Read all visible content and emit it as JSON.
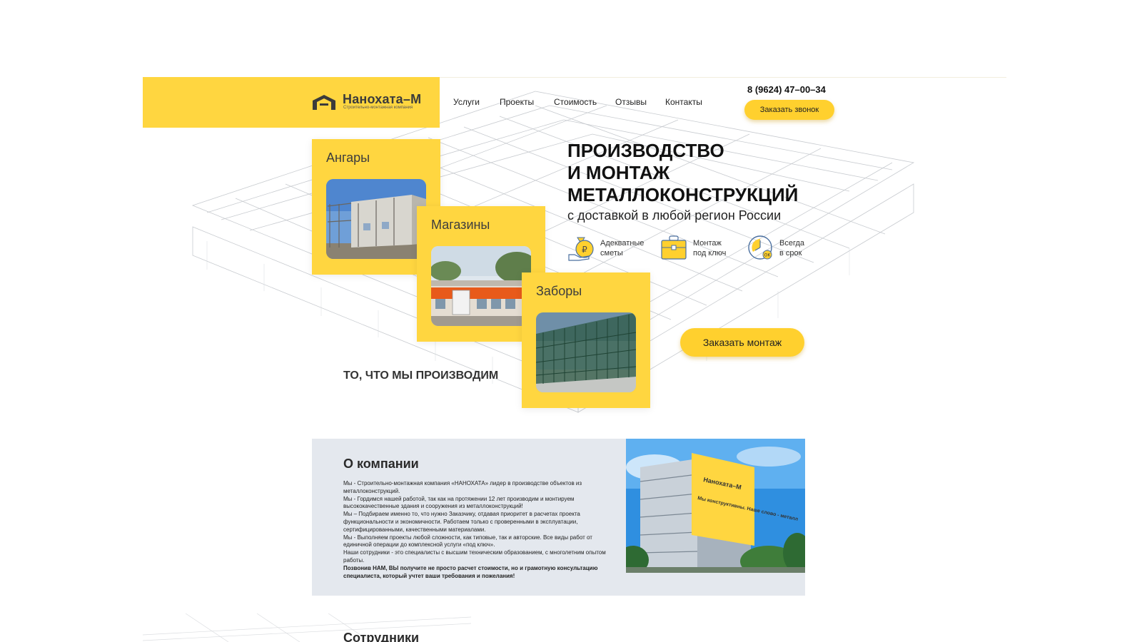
{
  "header": {
    "logo_name": "Нанохата–М",
    "logo_subtitle": "Строительно-монтажная компания",
    "nav": [
      "Услуги",
      "Проекты",
      "Стоимость",
      "Отзывы",
      "Контакты"
    ],
    "phone": "8 (9624) 47–00–34",
    "call_button": "Заказать звонок"
  },
  "hero": {
    "title_lines": [
      "ПРОИЗВОДСТВО",
      "И МОНТАЖ",
      "МЕТАЛЛОКОНСТРУКЦИЙ"
    ],
    "subtitle": "с доставкой в любой регион России",
    "features": [
      {
        "line1": "Адекватные",
        "line2": "сметы",
        "icon": "money-bag-icon"
      },
      {
        "line1": "Монтаж",
        "line2": "под ключ",
        "icon": "briefcase-icon"
      },
      {
        "line1": "Всегда",
        "line2": "в срок",
        "icon": "clock-check-icon"
      }
    ],
    "cta_button": "Заказать монтаж"
  },
  "products": {
    "heading": "ТО, ЧТО МЫ ПРОИЗВОДИМ",
    "cards": [
      "Ангары",
      "Магазины",
      "Заборы"
    ]
  },
  "about": {
    "title": "О компании",
    "paragraphs": [
      "Мы - Строительно-монтажная компания «НАНОХАТА» лидер в производстве объектов из металлоконструкций.",
      "Мы - Гордимся нашей работой, так как на протяжении 12 лет производим и монтируем высококачественные здания и сооружения из металлоконструкций!",
      "Мы – Подбираем именно то, что нужно Заказчику, отдавая приоритет в расчетах проекта функциональности и экономичности. Работаем только с проверенными в эксплуатации, сертифицированными, качественными материалами.",
      "Мы - Выполняем проекты любой сложности, как типовые, так и авторские. Все виды работ от единичной операции до комплексной услуги «под ключ».",
      "Наши сотрудники - это специалисты с высшим техническим образованием, с многолетним опытом работы."
    ],
    "bold_paragraph": "Позвонив НАМ, ВЫ получите не просто расчет стоимости, но и грамотную консультацию специалиста, который учтет ваши требования и пожелания!",
    "billboard_logo": "Нанохата–М",
    "billboard_slogan": "Мы конструктивны. Наше слово - металл"
  },
  "staff": {
    "title": "Сотрудники"
  },
  "colors": {
    "accent": "#ffd640",
    "button": "#ffd02e",
    "about_bg": "#e4e8ee"
  }
}
